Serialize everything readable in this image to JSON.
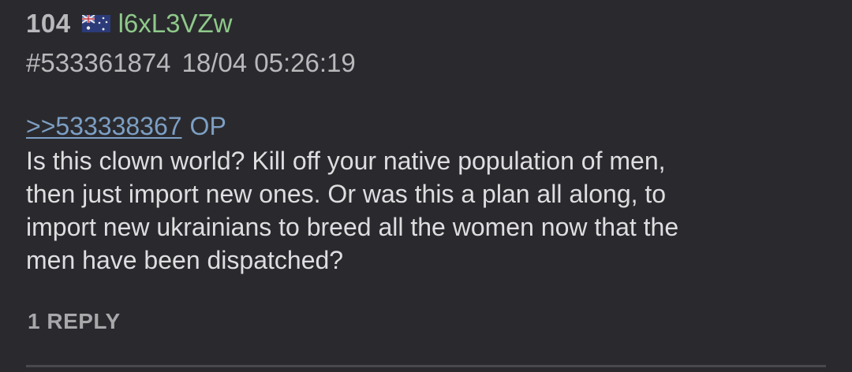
{
  "post": {
    "index": "104",
    "flag_icon": "australia-flag-icon",
    "poster_id": "l6xL3VZw",
    "number": "#533361874",
    "timestamp": "18/04 05:26:19",
    "quote_link": ">>533338367",
    "quote_tag": "OP",
    "body_lines": [
      "Is this clown world? Kill off your native population of men,",
      "then just import new ones. Or was this a plan all along, to",
      "import new ukrainians to breed all the women now that the",
      "men have been dispatched?"
    ],
    "reply_count_label": "1 REPLY"
  },
  "colors": {
    "background": "#2a2a2e",
    "poster_id": "#8fc98a",
    "quote_link": "#7d9fc4",
    "body_text": "#dedee0",
    "meta_text": "#b9b9bc"
  }
}
